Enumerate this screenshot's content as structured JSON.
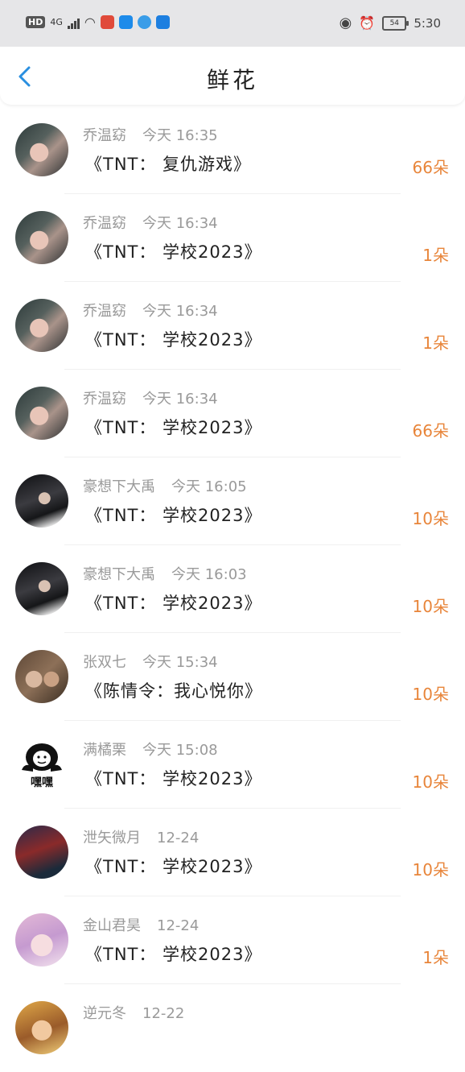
{
  "status_bar": {
    "hd": "HD",
    "network": "4G",
    "battery": "54",
    "time": "5:30"
  },
  "header": {
    "title": "鲜花"
  },
  "records": [
    {
      "user": "乔温窈",
      "time": "今天 16:35",
      "work": "《TNT： 复仇游戏》",
      "amount": "66朵"
    },
    {
      "user": "乔温窈",
      "time": "今天 16:34",
      "work": "《TNT： 学校2023》",
      "amount": "1朵"
    },
    {
      "user": "乔温窈",
      "time": "今天 16:34",
      "work": "《TNT： 学校2023》",
      "amount": "1朵"
    },
    {
      "user": "乔温窈",
      "time": "今天 16:34",
      "work": "《TNT： 学校2023》",
      "amount": "66朵"
    },
    {
      "user": "豪想下大禹",
      "time": "今天 16:05",
      "work": "《TNT： 学校2023》",
      "amount": "10朵"
    },
    {
      "user": "豪想下大禹",
      "time": "今天 16:03",
      "work": "《TNT： 学校2023》",
      "amount": "10朵"
    },
    {
      "user": "张双七",
      "time": "今天 15:34",
      "work": "《陈情令：我心悦你》",
      "amount": "10朵"
    },
    {
      "user": "满橘栗",
      "time": "今天 15:08",
      "work": "《TNT： 学校2023》",
      "amount": "10朵"
    },
    {
      "user": "泄矢微月",
      "time": "12-24",
      "work": "《TNT： 学校2023》",
      "amount": "10朵"
    },
    {
      "user": "金山君昊",
      "time": "12-24",
      "work": "《TNT： 学校2023》",
      "amount": "1朵"
    },
    {
      "user": "逆元冬",
      "time": "12-22",
      "work": "",
      "amount": ""
    }
  ],
  "avatar_stickers": {
    "heihei": "嘿嘿"
  },
  "colors": {
    "amount": "#e8853a",
    "accent_back": "#2a8fe0",
    "muted_text": "#9a9a9a"
  },
  "icons": {
    "back": "chevron-left-icon"
  }
}
